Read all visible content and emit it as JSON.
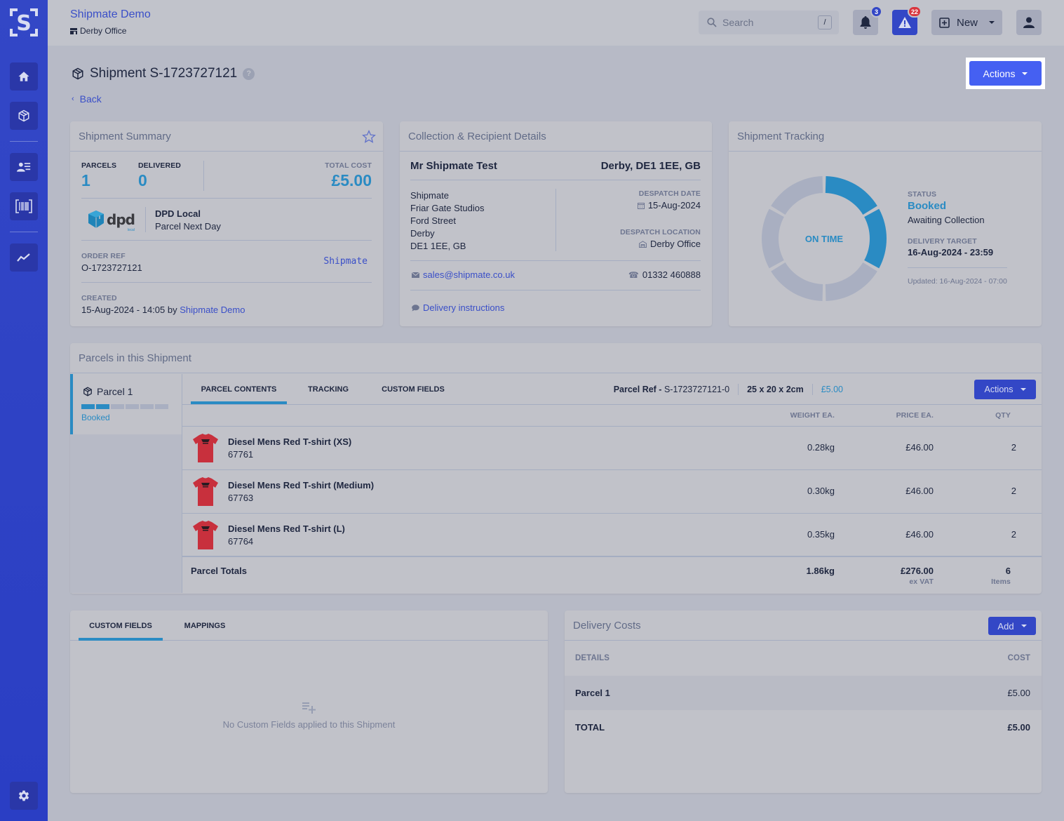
{
  "app": {
    "org_name": "Shipmate Demo",
    "location": "Derby Office"
  },
  "sidebar": {
    "items": [
      {
        "name": "home",
        "icon": "home-icon"
      },
      {
        "name": "shipments",
        "icon": "package-icon"
      },
      {
        "name": "contacts",
        "icon": "contact-list-icon"
      },
      {
        "name": "scan",
        "icon": "barcode-icon"
      },
      {
        "name": "analytics",
        "icon": "trend-chart-icon"
      },
      {
        "name": "settings",
        "icon": "gear-icon"
      }
    ]
  },
  "topbar": {
    "search_placeholder": "Search",
    "search_shortcut": "/",
    "notifications_count": "3",
    "alerts_count": "22",
    "new_label": "New"
  },
  "page": {
    "title": "Shipment S-1723727121",
    "help": "?",
    "back_label": "Back",
    "actions_label": "Actions"
  },
  "summary": {
    "title": "Shipment Summary",
    "parcels_label": "PARCELS",
    "parcels_value": "1",
    "delivered_label": "DELIVERED",
    "delivered_value": "0",
    "total_cost_label": "TOTAL COST",
    "total_cost_value": "£5.00",
    "carrier_logo": "dpd",
    "carrier_logo_sub": "local",
    "carrier_name": "DPD Local",
    "service_name": "Parcel Next Day",
    "order_ref_label": "ORDER REF",
    "order_ref_value": "O-1723727121",
    "source_brand": "Shipmate",
    "created_label": "CREATED",
    "created_value": "15-Aug-2024 - 14:05 by",
    "created_by": "Shipmate Demo"
  },
  "recipient": {
    "title": "Collection & Recipient Details",
    "name": "Mr Shipmate Test",
    "location_summary": "Derby, DE1 1EE, GB",
    "address_lines": [
      "Shipmate",
      "Friar Gate Studios",
      "Ford Street",
      "Derby",
      "DE1 1EE, GB"
    ],
    "despatch_date_label": "DESPATCH DATE",
    "despatch_date_value": "15-Aug-2024",
    "despatch_location_label": "DESPATCH LOCATION",
    "despatch_location_value": "Derby Office",
    "email": "sales@shipmate.co.uk",
    "phone": "01332 460888",
    "delivery_instructions_label": "Delivery instructions"
  },
  "tracking": {
    "title": "Shipment Tracking",
    "center_label": "ON TIME",
    "progress_steps_total": 6,
    "progress_steps_done": 2,
    "status_label": "STATUS",
    "status_value": "Booked",
    "status_detail": "Awaiting Collection",
    "delivery_target_label": "DELIVERY TARGET",
    "delivery_target_value": "16-Aug-2024 - 23:59",
    "updated": "Updated: 16-Aug-2024 - 07:00"
  },
  "parcels": {
    "title": "Parcels in this Shipment",
    "list": [
      {
        "label": "Parcel 1",
        "status": "Booked",
        "steps_total": 6,
        "steps_done": 2
      }
    ],
    "tabs": [
      "PARCEL CONTENTS",
      "TRACKING",
      "CUSTOM FIELDS"
    ],
    "active_tab": 0,
    "ref_label": "Parcel Ref -",
    "ref_value": "S-1723727121-0",
    "dimensions": "25 x 20 x 2cm",
    "cost": "£5.00",
    "actions_label": "Actions",
    "columns": [
      "WEIGHT EA.",
      "PRICE EA.",
      "QTY"
    ],
    "items": [
      {
        "name": "Diesel Mens Red T-shirt (XS)",
        "sku": "67761",
        "weight": "0.28kg",
        "price": "£46.00",
        "qty": "2"
      },
      {
        "name": "Diesel Mens Red T-shirt (Medium)",
        "sku": "67763",
        "weight": "0.30kg",
        "price": "£46.00",
        "qty": "2"
      },
      {
        "name": "Diesel Mens Red T-shirt (L)",
        "sku": "67764",
        "weight": "0.35kg",
        "price": "£46.00",
        "qty": "2"
      }
    ],
    "totals": {
      "label": "Parcel Totals",
      "weight": "1.86kg",
      "price": "£276.00",
      "price_note": "ex VAT",
      "qty": "6",
      "qty_note": "Items"
    }
  },
  "custom_fields": {
    "tabs": [
      "CUSTOM FIELDS",
      "MAPPINGS"
    ],
    "active_tab": 0,
    "empty_text": "No Custom Fields applied to this Shipment"
  },
  "delivery_costs": {
    "title": "Delivery Costs",
    "add_label": "Add",
    "columns": [
      "DETAILS",
      "COST"
    ],
    "rows": [
      {
        "detail": "Parcel 1",
        "cost": "£5.00"
      }
    ],
    "total_label": "TOTAL",
    "total_value": "£5.00"
  },
  "colors": {
    "brand": "#3347c6",
    "accent_blue": "#2a8bc3",
    "primary_button": "#4560f2",
    "alert_badge": "#d9363e"
  }
}
